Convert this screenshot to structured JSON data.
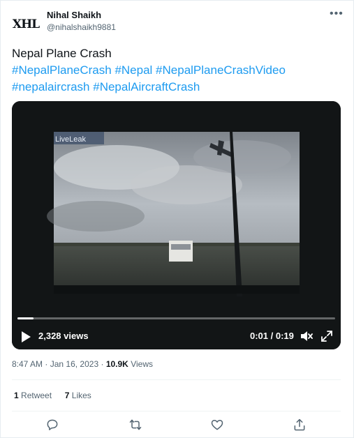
{
  "author": {
    "avatar_text": "XHL",
    "display_name": "Nihal Shaikh",
    "handle": "@nihalshaikh9881"
  },
  "tweet": {
    "title": "Nepal Plane Crash",
    "hashtags": [
      "#NepalPlaneCrash",
      "#Nepal",
      "#NepalPlaneCrashVideo",
      "#nepalaircrash",
      "#NepalAircraftCrash"
    ]
  },
  "video": {
    "views": "2,328 views",
    "time": "0:01 / 0:19",
    "progress": 0.05,
    "watermark": "LiveLeak"
  },
  "meta": {
    "time": "8:47 AM",
    "date": "Jan 16, 2023",
    "views_count": "10.9K",
    "views_label": "Views"
  },
  "stats": {
    "retweets_count": "1",
    "retweets_label": "Retweet",
    "likes_count": "7",
    "likes_label": "Likes"
  },
  "icons": [
    "more-icon",
    "play-icon",
    "mute-icon",
    "fullscreen-icon",
    "reply-icon",
    "retweet-icon",
    "like-icon",
    "share-icon"
  ],
  "colors": {
    "accent": "#1d9bf0",
    "text": "#0f1419",
    "muted": "#536471"
  }
}
